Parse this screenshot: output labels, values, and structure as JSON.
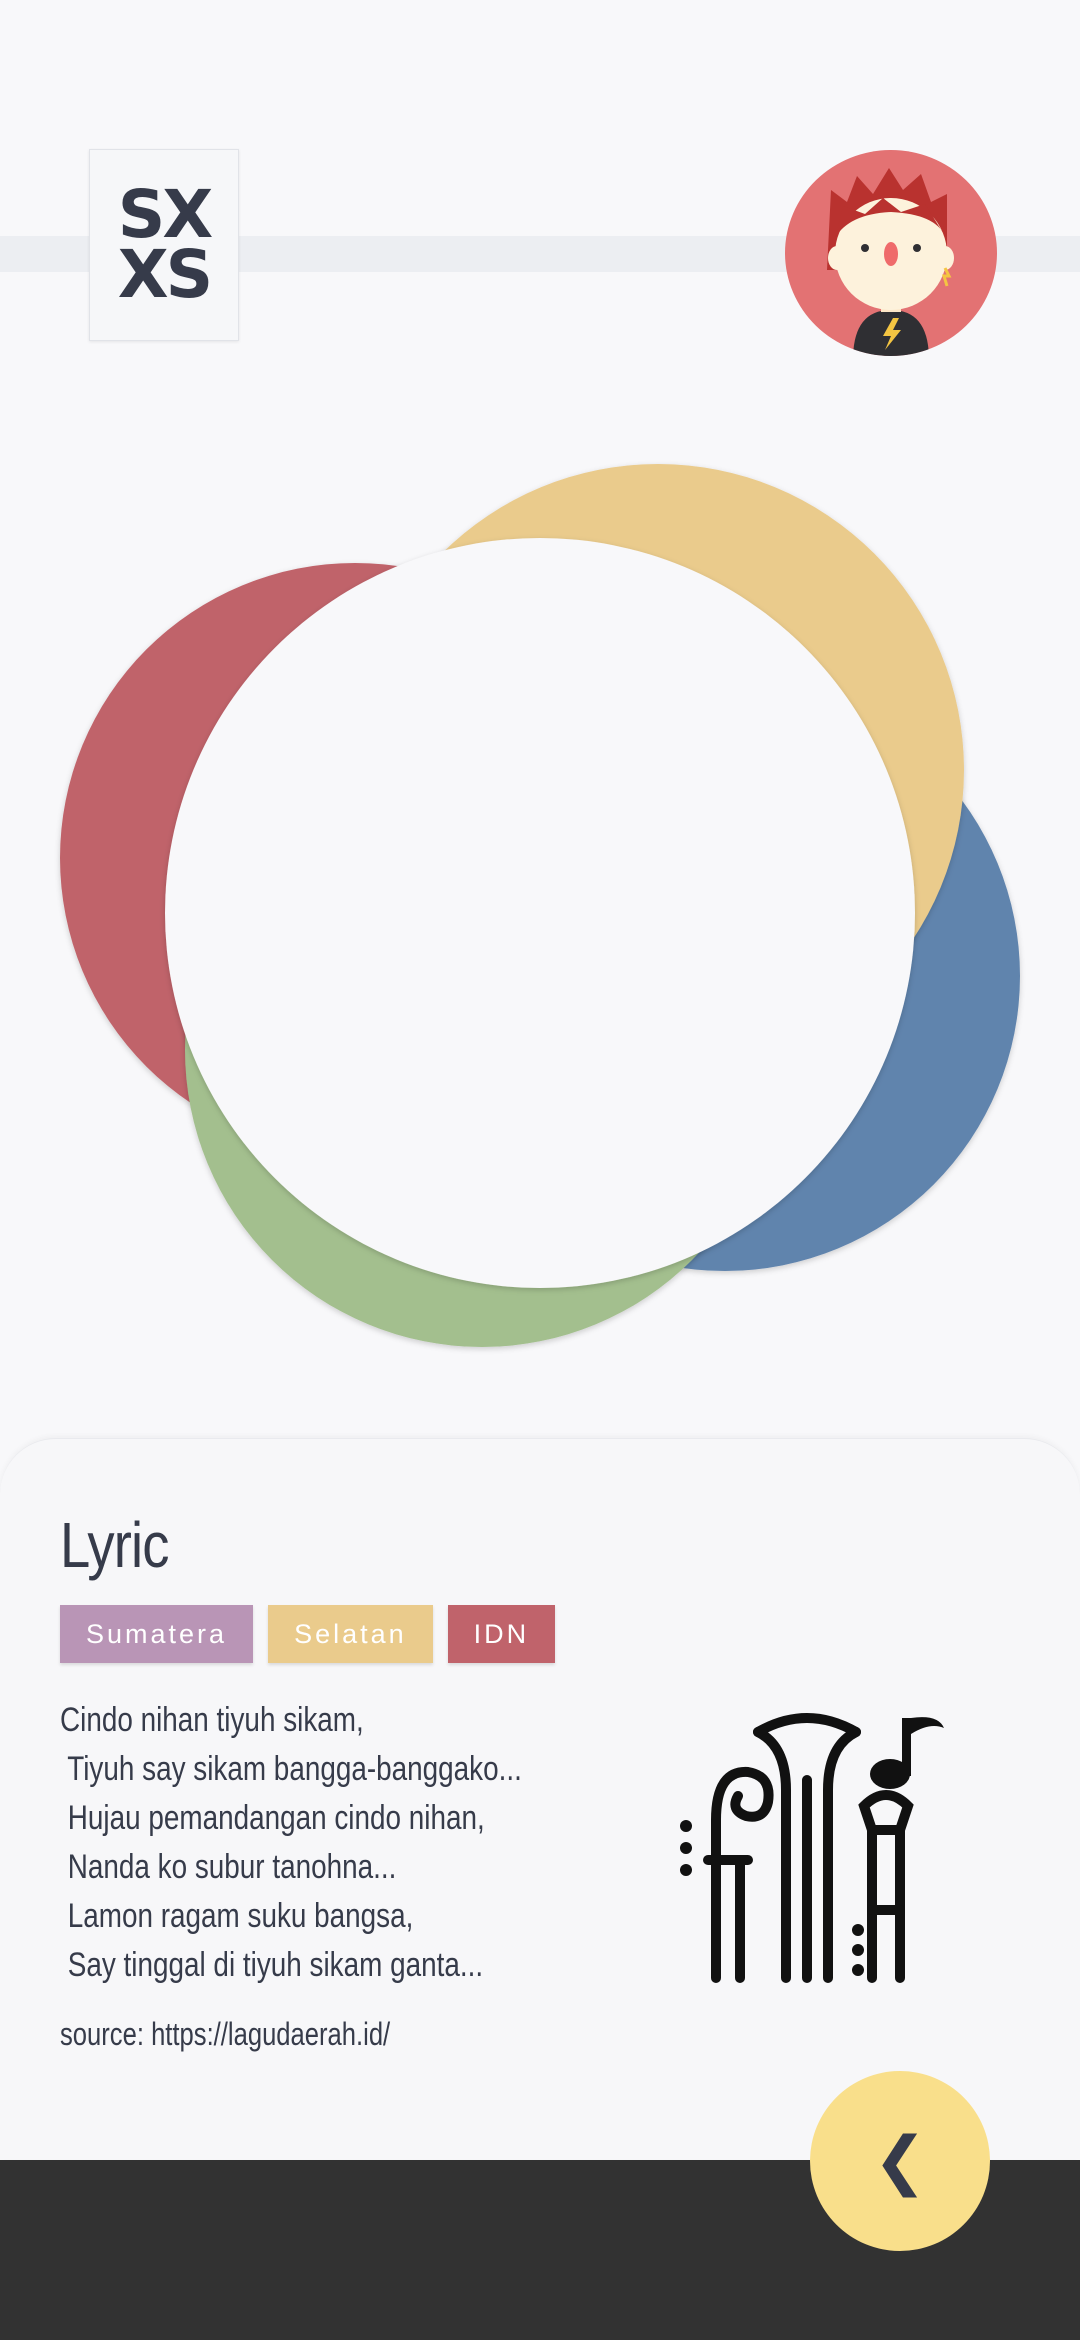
{
  "logo": {
    "line1": "SX",
    "line2": "XS"
  },
  "avatar": {
    "icon": "avatar-boy-icon"
  },
  "hero_colors": {
    "red": "#c0636b",
    "yellow": "#eacb8c",
    "blue": "#6184ad",
    "green": "#a3bf8e"
  },
  "lyric": {
    "title": "Lyric",
    "tags": [
      {
        "label": "Sumatera",
        "color": "#b995b6"
      },
      {
        "label": "Selatan",
        "color": "#eacb8c"
      },
      {
        "label": "IDN",
        "color": "#c0636b"
      }
    ],
    "lines": [
      "Cindo nihan tiyuh sikam,",
      " Tiyuh say sikam bangga-banggako...",
      " Hujau pemandangan cindo nihan,",
      " Nanda ko subur tanohna...",
      " Lamon ragam suku bangsa,",
      " Say tinggal di tiyuh sikam ganta..."
    ],
    "source": "source: https://lagudaerah.id/",
    "icon": "music-instruments-icon"
  },
  "back_button": {
    "label": "❮",
    "icon": "chevron-left-icon"
  }
}
